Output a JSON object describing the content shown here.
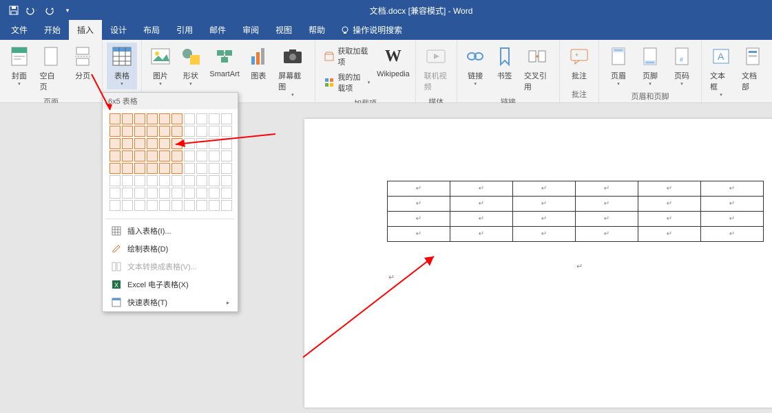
{
  "title": "文档.docx [兼容模式]  -  Word",
  "qat": {
    "save": "save",
    "undo": "undo",
    "redo": "redo"
  },
  "tabs": {
    "file": "文件",
    "home": "开始",
    "insert": "插入",
    "design": "设计",
    "layout": "布局",
    "references": "引用",
    "mailings": "邮件",
    "review": "审阅",
    "view": "视图",
    "help": "帮助"
  },
  "tell_me": "操作说明搜索",
  "ribbon": {
    "pages": {
      "label": "页面",
      "cover": "封面",
      "blank": "空白页",
      "pagebreak": "分页"
    },
    "table": {
      "label": "表格",
      "btn": "表格"
    },
    "illustrations": {
      "pictures": "图片",
      "shapes": "形状",
      "smartart": "SmartArt",
      "chart": "图表",
      "screenshot": "屏幕截图"
    },
    "addins": {
      "label": "加载项",
      "get": "获取加载项",
      "my": "我的加载项",
      "wikipedia": "Wikipedia"
    },
    "media": {
      "label": "媒体",
      "video": "联机视频"
    },
    "links": {
      "label": "链接",
      "link": "链接",
      "bookmark": "书签",
      "crossref": "交叉引用"
    },
    "comments": {
      "label": "批注",
      "comment": "批注"
    },
    "headerfooter": {
      "label": "页眉和页脚",
      "header": "页眉",
      "footer": "页脚",
      "pagenum": "页码"
    },
    "text": {
      "textbox": "文本框",
      "parts": "文档部"
    }
  },
  "dropdown": {
    "header": "6x5 表格",
    "insert_table": "插入表格(I)...",
    "draw_table": "绘制表格(D)",
    "convert_text": "文本转换成表格(V)...",
    "excel": "Excel 电子表格(X)",
    "quick_tables": "快速表格(T)"
  },
  "grid_selection": {
    "cols": 6,
    "rows": 5,
    "total_cols": 10,
    "total_rows": 8
  },
  "doc_table": {
    "cols": 6,
    "rows": 4
  },
  "colors": {
    "accent": "#2b579a",
    "orange": "#ed7d31",
    "red": "#ff0000"
  }
}
